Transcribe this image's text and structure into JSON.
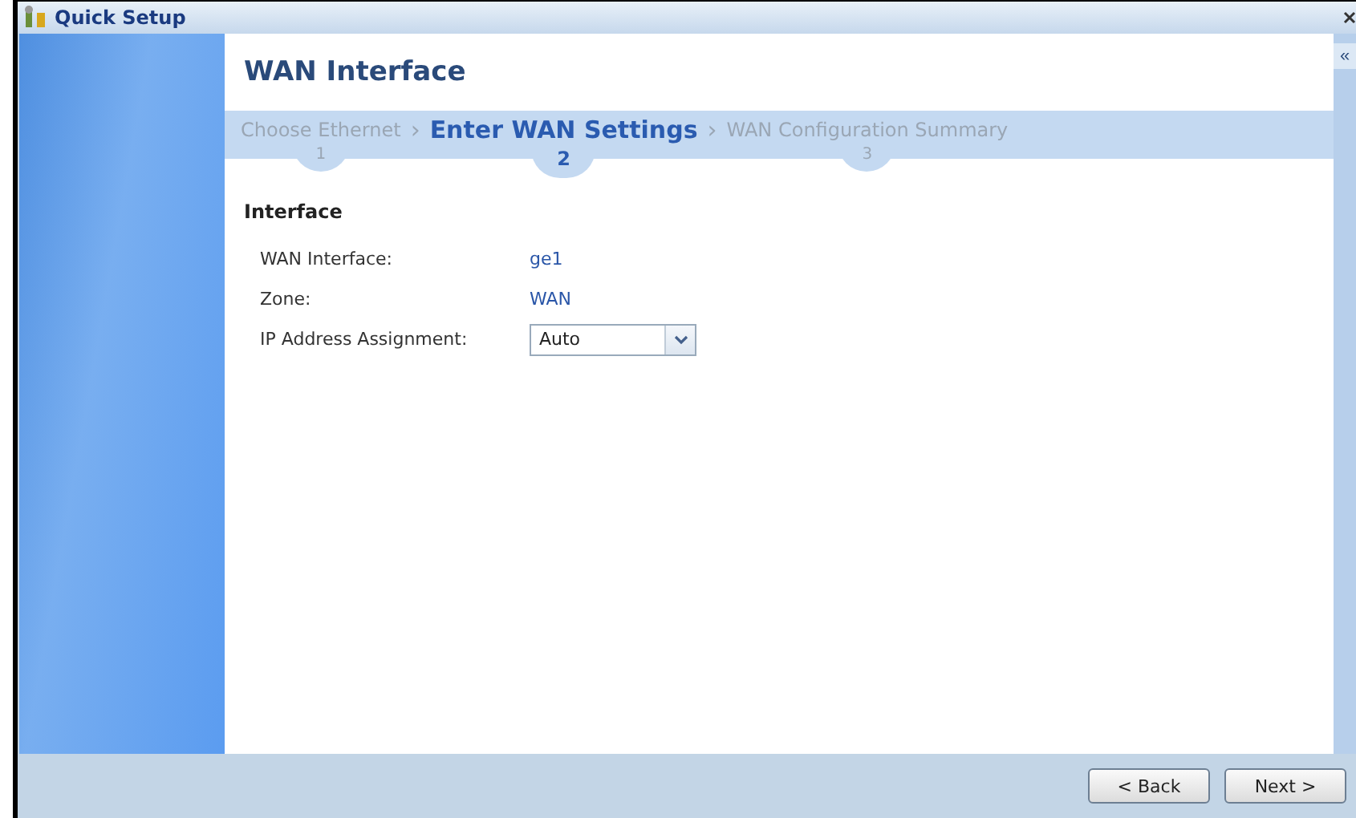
{
  "window": {
    "title": "Quick Setup"
  },
  "collapse_button": "«",
  "page_title": "WAN Interface",
  "steps": [
    {
      "label": "Choose Ethernet",
      "number": "1",
      "selected": false
    },
    {
      "label": "Enter WAN Settings",
      "number": "2",
      "selected": true
    },
    {
      "label": "WAN Configuration Summary",
      "number": "3",
      "selected": false
    }
  ],
  "separator": "›",
  "section": {
    "title": "Interface",
    "fields": [
      {
        "kind": "text",
        "label": "WAN Interface:",
        "value": "ge1"
      },
      {
        "kind": "text",
        "label": "Zone:",
        "value": "WAN"
      },
      {
        "kind": "select",
        "label": "IP Address Assignment:",
        "value": "Auto"
      }
    ]
  },
  "buttons": [
    "< Back",
    "Next >"
  ]
}
